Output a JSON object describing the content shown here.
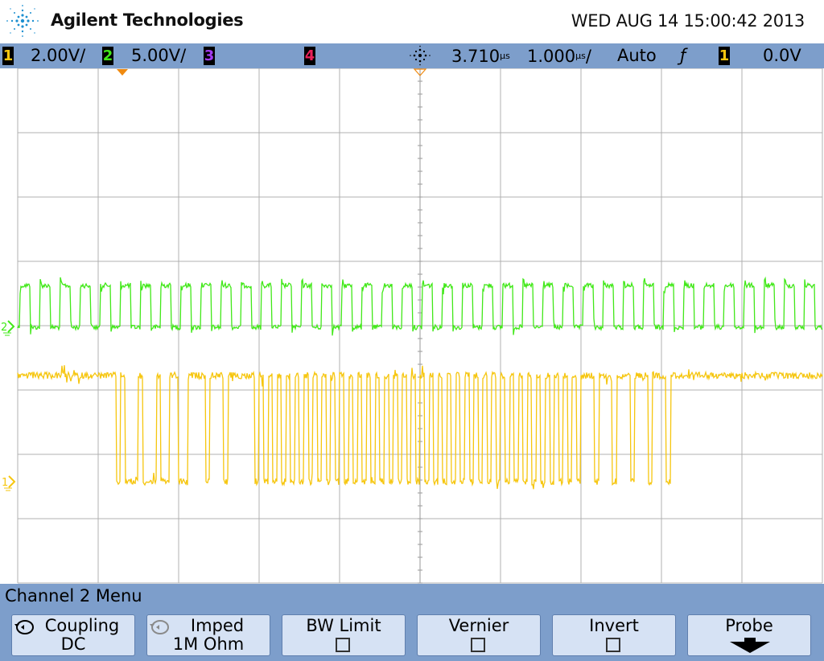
{
  "header": {
    "brand": "Agilent Technologies",
    "datetime": "WED AUG 14 15:00:42 2013",
    "logo_icon": "agilent-spark-icon"
  },
  "status": {
    "ch1_label": "1",
    "ch1_scale": "2.00V/",
    "ch2_label": "2",
    "ch2_scale": "5.00V/",
    "ch3_label": "3",
    "ch4_label": "4",
    "trigger_icon": "trigger-sun-icon",
    "delay": "3.710",
    "delay_unit": "µs",
    "timebase": "1.000",
    "timebase_unit": "µs",
    "timebase_suffix": "/",
    "trigger_mode": "Auto",
    "slope_icon": "rising-edge-icon",
    "slope_glyph": "ƒ",
    "trigger_source": "1",
    "trigger_level": "0.0V"
  },
  "colors": {
    "ch1": "#f6c60f",
    "ch2": "#41e818",
    "ch3": "#a23cf0",
    "ch4": "#e8205a",
    "bar": "#7d9ecb",
    "softkey": "#d6e2f4",
    "marker": "#f08a10",
    "grid": "#b0b0b0"
  },
  "screen": {
    "ch1_marker_label": "1",
    "ch2_marker_label": "2",
    "ch1_data_bits": "111111111111111111111101000100010011001111011101111110101010101010101010101010101010101010101010101010101010101010101010101010111011101110111011101111111111111111111111111111111111",
    "ch2_clock_periods": 40
  },
  "menu": {
    "title": "Channel 2  Menu",
    "softkeys": [
      {
        "line1": "Coupling",
        "line2": "DC",
        "icon": "rotate-icon"
      },
      {
        "line1": "Imped",
        "line2": "1M Ohm",
        "icon": "rotate-icon-dim"
      },
      {
        "line1": "BW Limit",
        "checkbox": true
      },
      {
        "line1": "Vernier",
        "checkbox": true
      },
      {
        "line1": "Invert",
        "checkbox": true
      },
      {
        "line1": "Probe",
        "icon": "down-arrow-icon"
      }
    ]
  }
}
